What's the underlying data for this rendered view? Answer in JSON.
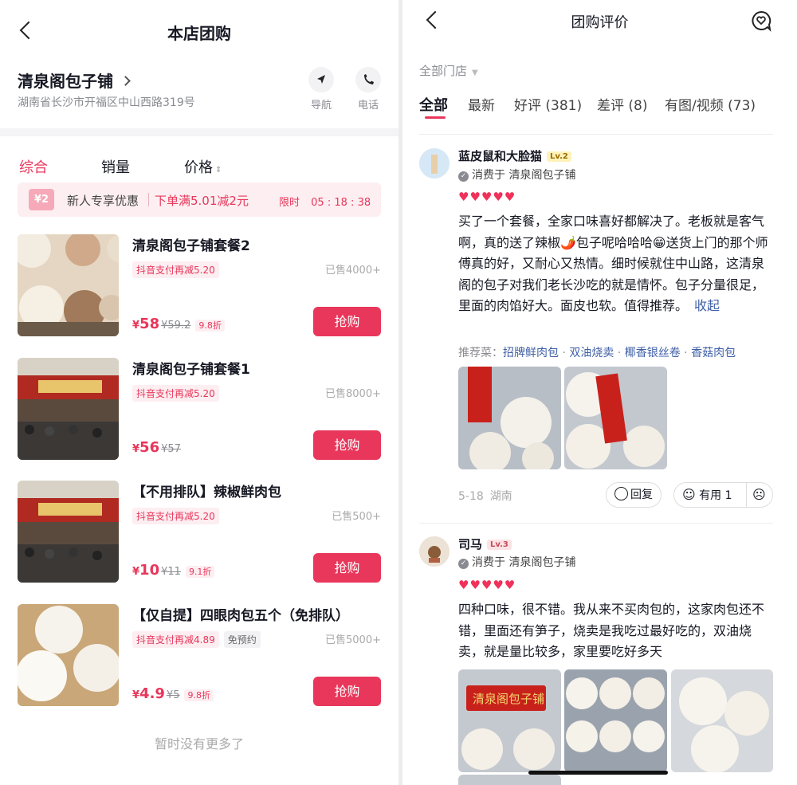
{
  "left": {
    "title": "本店团购",
    "shop": {
      "name": "清泉阁包子铺",
      "address": "湖南省长沙市开福区中山西路319号",
      "nav_label": "导航",
      "phone_label": "电话"
    },
    "sort_tabs": [
      "综合",
      "销量",
      "价格"
    ],
    "promo": {
      "coupon": "¥2",
      "label": "新人专享优惠",
      "offer": "下单满5.01减2元",
      "timer_label": "限时",
      "timer": [
        "05",
        "18",
        "38"
      ]
    },
    "products": [
      {
        "name": "清泉阁包子铺套餐2",
        "tag": "抖音支付再减5.20",
        "tag2": "",
        "sold": "已售4000+",
        "price": "58",
        "orig": "¥59.2",
        "disc": "9.8折",
        "buy": "抢购"
      },
      {
        "name": "清泉阁包子铺套餐1",
        "tag": "抖音支付再减5.20",
        "tag2": "",
        "sold": "已售8000+",
        "price": "56",
        "orig": "¥57",
        "disc": "",
        "buy": "抢购"
      },
      {
        "name": "【不用排队】辣椒鲜肉包",
        "tag": "抖音支付再减5.20",
        "tag2": "",
        "sold": "已售500+",
        "price": "10",
        "orig": "¥11",
        "disc": "9.1折",
        "buy": "抢购"
      },
      {
        "name": "【仅自提】四眼肉包五个（免排队）",
        "tag": "抖音支付再减4.89",
        "tag2": "免预约",
        "sold": "已售5000+",
        "price": "4.9",
        "orig": "¥5",
        "disc": "9.8折",
        "buy": "抢购"
      }
    ],
    "currency": "¥",
    "end_text": "暂时没有更多了"
  },
  "right": {
    "title": "团购评价",
    "store_filter": "全部门店",
    "tabs": [
      "全部",
      "最新",
      "好评 (381)",
      "差评 (8)",
      "有图/视频 (73)"
    ],
    "reviews": [
      {
        "user": "蓝皮鼠和大脸猫",
        "level": "Lv.2",
        "consume": "消费于 清泉阁包子铺",
        "hearts": "♥♥♥♥♥",
        "text": "买了一个套餐，全家口味喜好都解决了。老板就是客气啊，真的送了辣椒🌶️包子呢哈哈哈😁送货上门的那个师傅真的好，又耐心又热情。细时候就住中山路，这清泉阁的包子对我们老长沙吃的就是情怀。包子分量很足，里面的肉馅好大。面皮也软。值得推荐。",
        "collapse": "收起",
        "rec_label": "推荐菜：",
        "dishes": [
          "招牌鲜肉包",
          "双油烧卖",
          "椰香银丝卷",
          "香菇肉包"
        ],
        "date": "5-18",
        "location": "湖南",
        "reply": "回复",
        "useful": "有用 1"
      },
      {
        "user": "司马",
        "level": "Lv.3",
        "consume": "消费于 清泉阁包子铺",
        "hearts": "♥♥♥♥♥",
        "text": "四种口味，很不错。我从来不买肉包的，这家肉包还不错，里面还有笋子，烧卖是我吃过最好吃的，双油烧卖，就是量比较多，家里要吃好多天"
      }
    ],
    "sign_text": "清泉阁包子铺"
  },
  "colors": {
    "accent": "#e8375b",
    "link": "#3f5fa5",
    "heart": "#f0315a"
  }
}
